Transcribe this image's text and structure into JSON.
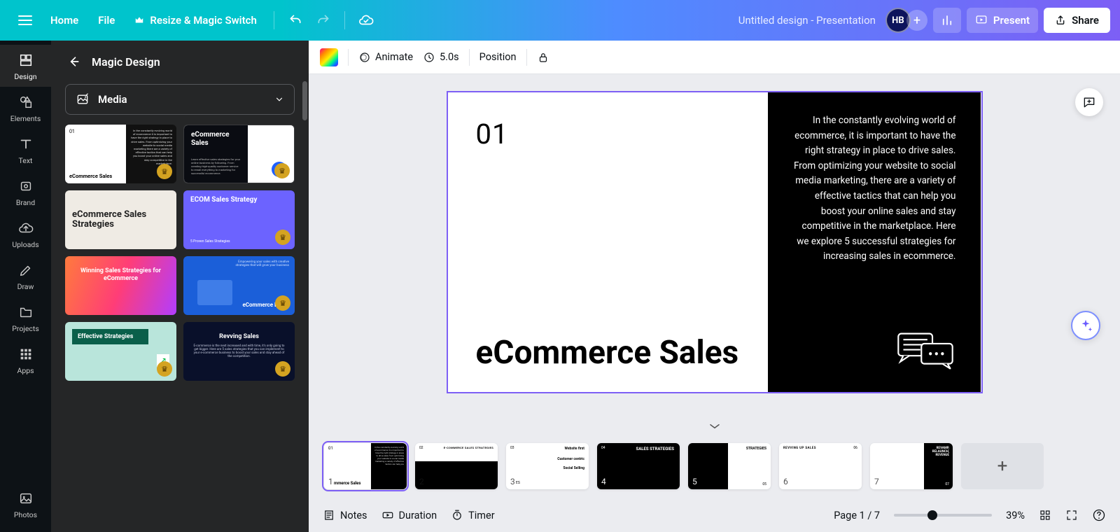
{
  "header": {
    "home": "Home",
    "file": "File",
    "resize": "Resize & Magic Switch",
    "doc_title": "Untitled design - Presentation",
    "avatar_initials": "HB",
    "present": "Present",
    "share": "Share"
  },
  "rail": {
    "design": "Design",
    "elements": "Elements",
    "text": "Text",
    "brand": "Brand",
    "uploads": "Uploads",
    "draw": "Draw",
    "projects": "Projects",
    "apps": "Apps",
    "photos": "Photos"
  },
  "panel": {
    "title": "Magic Design",
    "media_label": "Media",
    "templates": [
      {
        "label": "eCommerce Sales"
      },
      {
        "label": "eCommerce Sales"
      },
      {
        "label": "eCommerce Sales Strategies"
      },
      {
        "label": "ECOM Sales Strategy"
      },
      {
        "label": "Winning Sales Strategies for eCommerce"
      },
      {
        "label": "eCommerce Boost"
      },
      {
        "label": "Effective Strategies"
      },
      {
        "label": "Revving Sales"
      }
    ]
  },
  "toolbar": {
    "animate": "Animate",
    "duration": "5.0s",
    "position": "Position"
  },
  "slide": {
    "number": "01",
    "title": "eCommerce Sales",
    "body": "In the constantly evolving world of ecommerce, it is important to have the right strategy in place to drive sales. From optimizing your website to social media marketing, there are a variety of effective tactics that can help you boost your online sales and stay competitive in the marketplace. Here we explore 5 successful strategies for increasing sales in ecommerce."
  },
  "thumbs": [
    {
      "label": "mmerce Sales"
    },
    {
      "label": "E-COMMERCE SALES STRATEGIES"
    },
    {
      "label": "Website first"
    },
    {
      "label": "SALES STRATEGIES"
    },
    {
      "label": "STRATEGIES"
    },
    {
      "label": "REVVING UP SALES"
    },
    {
      "label": "REVAMP, RELAUNCH, REVENUE"
    }
  ],
  "bottom": {
    "notes": "Notes",
    "duration": "Duration",
    "timer": "Timer",
    "page_info": "Page 1 / 7",
    "zoom": "39%"
  }
}
